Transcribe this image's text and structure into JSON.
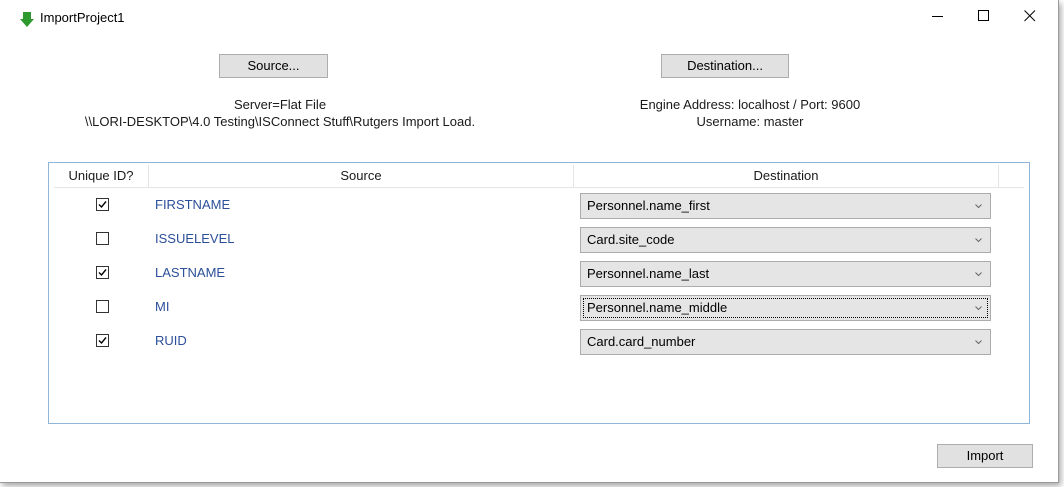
{
  "window": {
    "title": "ImportProject1",
    "icon": "green-down-arrow-icon"
  },
  "buttons": {
    "source": "Source...",
    "destination": "Destination...",
    "import": "Import"
  },
  "source_info": {
    "line1": "Server=Flat File",
    "line2": "\\\\LORI-DESKTOP\\4.0 Testing\\ISConnect Stuff\\Rutgers Import Load."
  },
  "destination_info": {
    "line1": "Engine Address: localhost / Port: 9600",
    "line2": "Username: master"
  },
  "table": {
    "headers": [
      "Unique ID?",
      "Source",
      "Destination"
    ],
    "rows": [
      {
        "unique": true,
        "source": "FIRSTNAME",
        "destination": "Personnel.name_first"
      },
      {
        "unique": false,
        "source": "ISSUELEVEL",
        "destination": "Card.site_code"
      },
      {
        "unique": true,
        "source": "LASTNAME",
        "destination": "Personnel.name_last"
      },
      {
        "unique": false,
        "source": "MI",
        "destination": "Personnel.name_middle"
      },
      {
        "unique": true,
        "source": "RUID",
        "destination": "Card.card_number"
      }
    ]
  },
  "colors": {
    "source_text": "#2b4f98",
    "grid_border": "#8fb6d9",
    "button_bg": "#e1e1e1"
  }
}
